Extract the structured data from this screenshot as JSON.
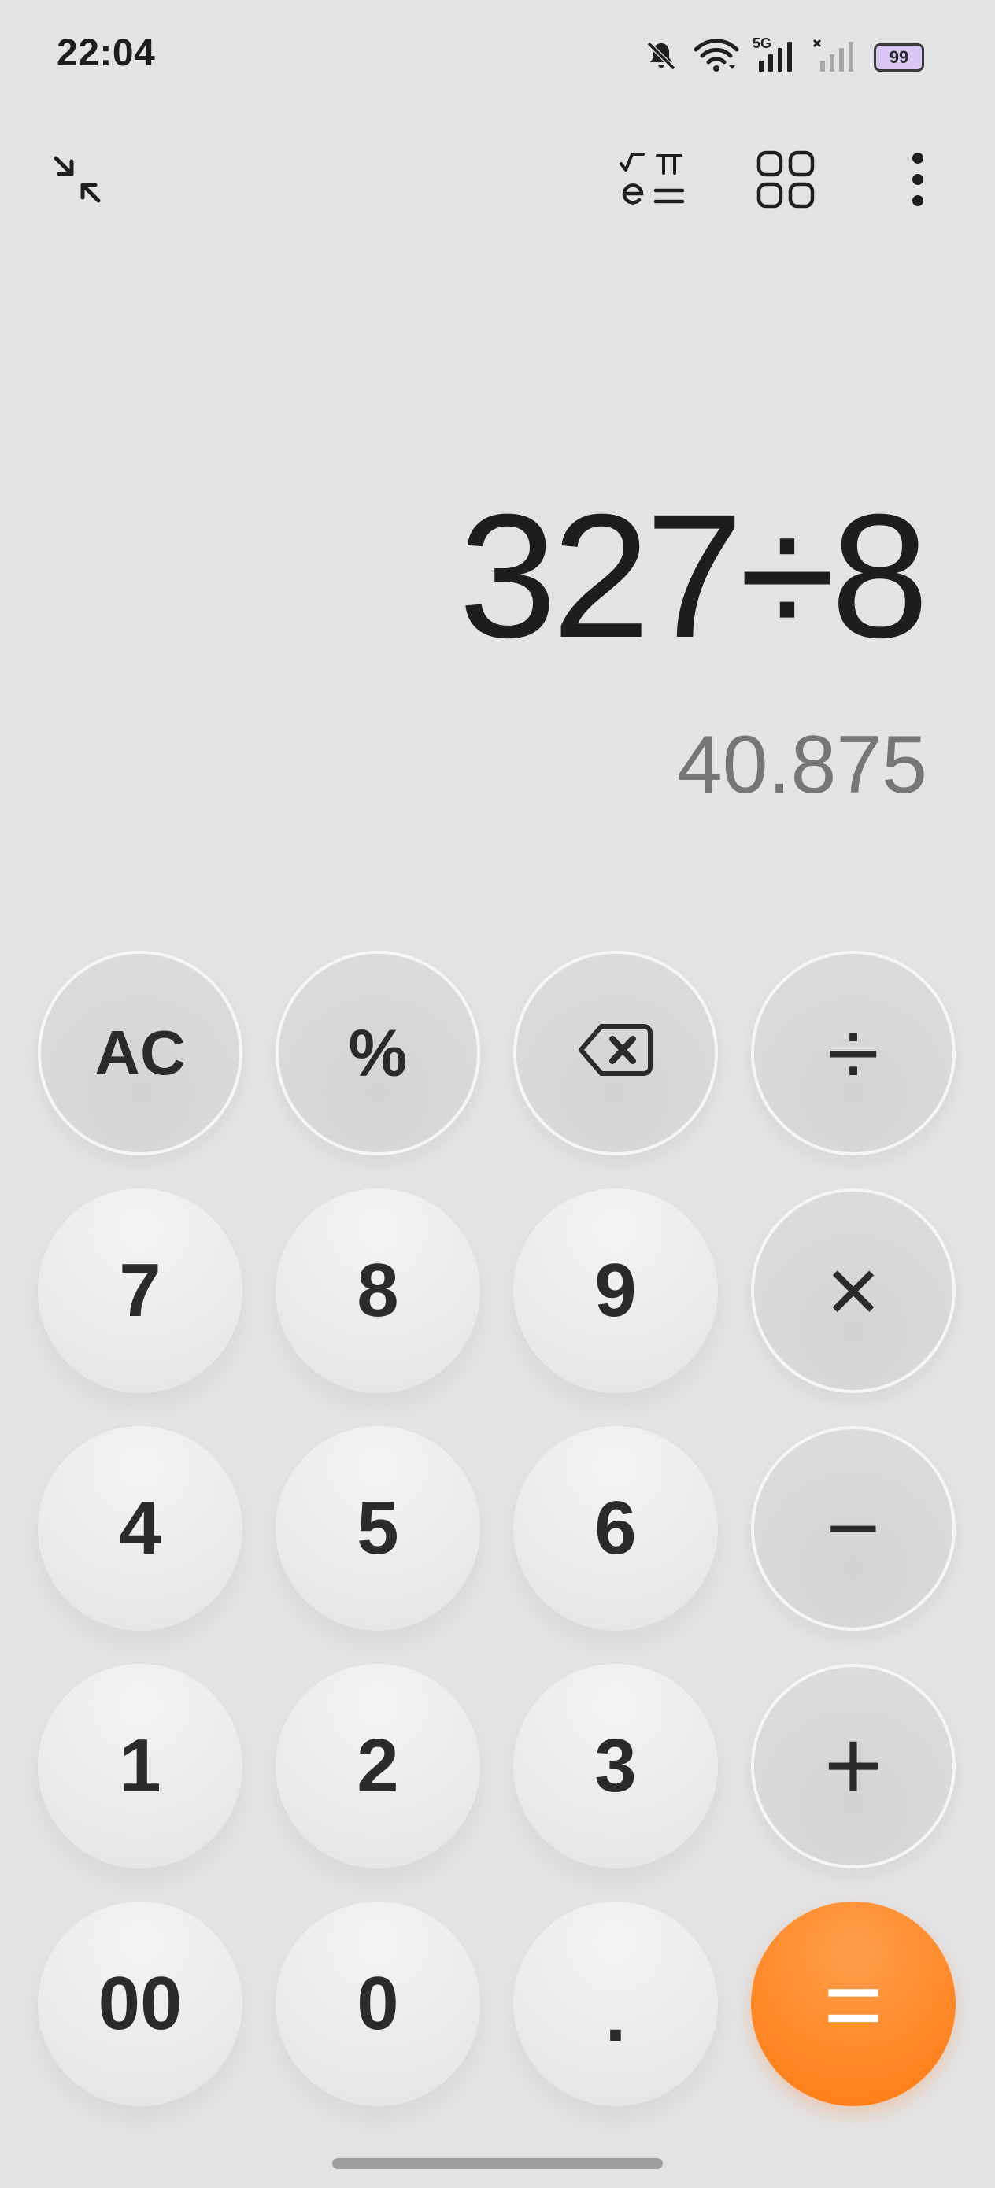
{
  "status_bar": {
    "time": "22:04",
    "icons": [
      "mute-icon",
      "wifi-icon",
      "signal-5g-icon",
      "signal-nosim-icon"
    ],
    "network_label": "5G",
    "battery_level": "99"
  },
  "toolbar": {
    "icons": [
      "collapse-icon",
      "scientific-icon",
      "grid-icon",
      "more-icon"
    ]
  },
  "display": {
    "expression": "327÷8",
    "result": "40.875"
  },
  "keys": {
    "ac": "AC",
    "percent": "%",
    "backspace": "backspace-icon",
    "divide": "÷",
    "seven": "7",
    "eight": "8",
    "nine": "9",
    "multiply": "×",
    "four": "4",
    "five": "5",
    "six": "6",
    "minus": "−",
    "one": "1",
    "two": "2",
    "three": "3",
    "plus": "+",
    "double_zero": "00",
    "zero": "0",
    "dot": ".",
    "equals": "="
  },
  "colors": {
    "background": "#e2e3e5",
    "equals_accent": "#ff8a2a",
    "result_text": "#767676"
  }
}
